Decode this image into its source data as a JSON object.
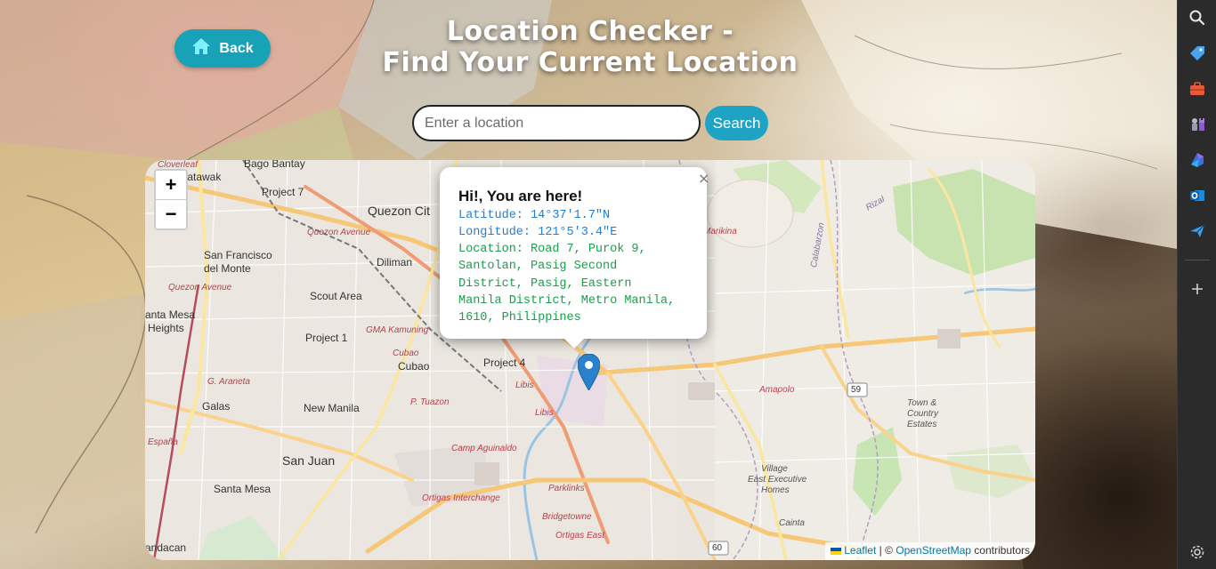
{
  "header": {
    "back_label": "Back",
    "title_line1": "Location Checker -",
    "title_line2": "Find Your Current Location"
  },
  "search": {
    "placeholder": "Enter a location",
    "value": "",
    "button_label": "Search"
  },
  "map": {
    "zoom_in": "+",
    "zoom_out": "−",
    "popup": {
      "title": "Hi!, You are here!",
      "latitude": "Latitude: 14°37'1.7\"N",
      "longitude": "Longitude: 121°5'3.4\"E",
      "location": "Location: Road 7, Purok 9,\nSantolan, Pasig Second\nDistrict, Pasig, Eastern\nManila District, Metro Manila,\n1610, Philippines",
      "close": "×"
    },
    "labels": {
      "cloverleaf": "Cloverleaf",
      "tatawak": "tatawak",
      "bago_bantay": "Bago Bantay",
      "project7": "Project 7",
      "quezon_city": "Quezon Cit",
      "quezon_avenue": "Quezon Avenue",
      "san_francisco": "San Francisco",
      "del_monte": "del Monte",
      "diliman": "Diliman",
      "quezon_avenue2": "Quezon Avenue",
      "scout_area": "Scout Area",
      "santa_mesa_heights1": "anta Mesa",
      "santa_mesa_heights2": "Heights",
      "gma_kamuning": "GMA Kamuning",
      "project1": "Project 1",
      "cubao_road": "Cubao",
      "cubao": "Cubao",
      "project4": "Project 4",
      "libis": "Libis",
      "libis2": "Libis",
      "g_araneta": "G. Araneta",
      "galas": "Galas",
      "new_manila": "New Manila",
      "p_tuazon": "P. Tuazon",
      "espana": "España",
      "san_juan": "San Juan",
      "camp_aguinaldo": "Camp Aguinaldo",
      "santa_mesa": "Santa Mesa",
      "ortigas_interchange": "Ortigas Interchange",
      "parklinks": "Parklinks",
      "bridgetowne": "Bridgetowne",
      "ortigas_east": "Ortigas East",
      "andacan": "andacan",
      "marikina": "Marikina",
      "amapolo": "Amapolo",
      "town_country1": "Town &",
      "town_country2": "Country",
      "town_country3": "Estates",
      "village_east1": "Village",
      "village_east2": "East Executive",
      "village_east3": "Homes",
      "cainta": "Cainta",
      "calabarzon": "Calabarzon",
      "rizal": "Rizal",
      "shield_59": "59",
      "shield_60": "60"
    },
    "attribution": {
      "leaflet": "Leaflet",
      "separator": " | © ",
      "osm": "OpenStreetMap",
      "contributors": " contributors"
    }
  },
  "colors": {
    "back_button": "#17a2b8",
    "search_button": "#1fa3c4",
    "latlon_text": "#1e7fd8",
    "location_text": "#19a04a",
    "marker": "#2a81cb"
  },
  "sidebar": {
    "icons": [
      "search-icon",
      "tag-icon",
      "briefcase-icon",
      "chess-icon",
      "copilot-icon",
      "outlook-icon",
      "send-icon",
      "add-icon",
      "settings-icon"
    ]
  }
}
